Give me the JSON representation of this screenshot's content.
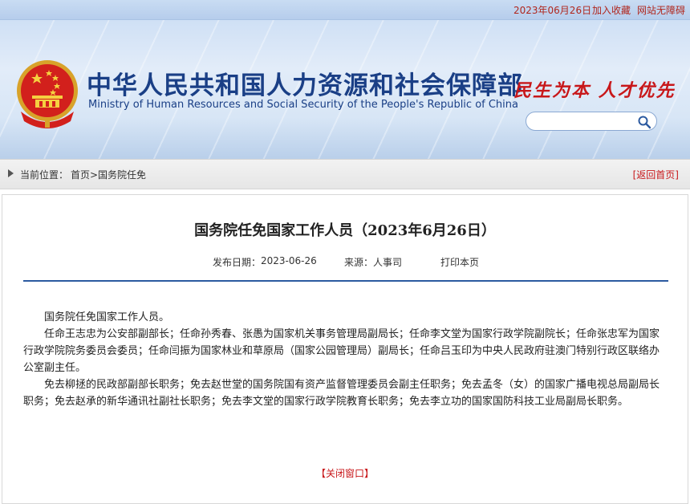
{
  "topbar": {
    "date": "2023年06月26日",
    "bookmark": "加入收藏",
    "accessibility": "网站无障碍"
  },
  "header": {
    "title_cn": "中华人民共和国人力资源和社会保障部",
    "title_en": "Ministry of Human Resources and Social Security of the People's Republic of China",
    "slogan": "民生为本 人才优先",
    "search_placeholder": ""
  },
  "breadcrumb": {
    "label": "当前位置：",
    "path": "首页>国务院任免",
    "back": "[返回首页]"
  },
  "article": {
    "title": "国务院任免国家工作人员（2023年6月26日）",
    "publish_label": "发布日期：",
    "publish_date": "2023-06-26",
    "source_label": "来源：",
    "source": "人事司",
    "print": "打印本页",
    "paragraphs": [
      "国务院任免国家工作人员。",
      "任命王志忠为公安部副部长；任命孙秀春、张愚为国家机关事务管理局副局长；任命李文堂为国家行政学院副院长；任命张忠军为国家行政学院院务委员会委员；任命闫振为国家林业和草原局（国家公园管理局）副局长；任命吕玉印为中央人民政府驻澳门特别行政区联络办公室副主任。",
      "免去柳拯的民政部副部长职务；免去赵世堂的国务院国有资产监督管理委员会副主任职务；免去孟冬（女）的国家广播电视总局副局长职务；免去赵承的新华通讯社副社长职务；免去李文堂的国家行政学院教育长职务；免去李立功的国家国防科技工业局副局长职务。"
    ],
    "close": "【关闭窗口】"
  },
  "colors": {
    "brand_blue": "#1a3f86",
    "accent_red": "#c8171a",
    "rule_blue": "#2c5aa0"
  },
  "icons": {
    "emblem": "national-emblem-icon",
    "search": "search-icon",
    "breadcrumb": "triangle-right-icon"
  }
}
